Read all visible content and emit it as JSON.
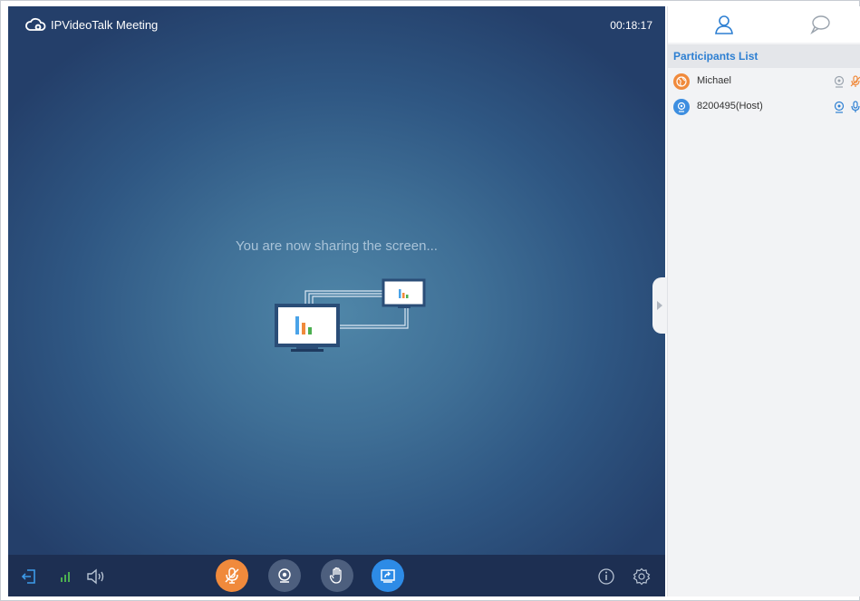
{
  "header": {
    "app_title": "IPVideoTalk Meeting",
    "timer": "00:18:17"
  },
  "stage": {
    "sharing_message": "You are now sharing the screen..."
  },
  "toolbar": {
    "exit_icon": "exit-icon",
    "signal_icon": "signal-icon",
    "speaker_icon": "speaker-icon",
    "mic_icon": "mic-muted-icon",
    "camera_icon": "camera-icon",
    "hand_icon": "raise-hand-icon",
    "share_icon": "screen-share-icon",
    "info_icon": "info-icon",
    "settings_icon": "settings-icon"
  },
  "sidebar": {
    "tabs": [
      {
        "icon": "participants-icon"
      },
      {
        "icon": "chat-icon"
      }
    ],
    "participants_title": "Participants List",
    "participants": [
      {
        "name": "Michael",
        "avatar_color": "#f08a3c",
        "mic_muted": true
      },
      {
        "name": "8200495(Host)",
        "avatar_color": "#3d8ee0",
        "mic_muted": false
      }
    ]
  },
  "colors": {
    "accent_orange": "#f08a3c",
    "accent_blue": "#2d7fd2",
    "toolbar_bg": "#1d2f52"
  }
}
